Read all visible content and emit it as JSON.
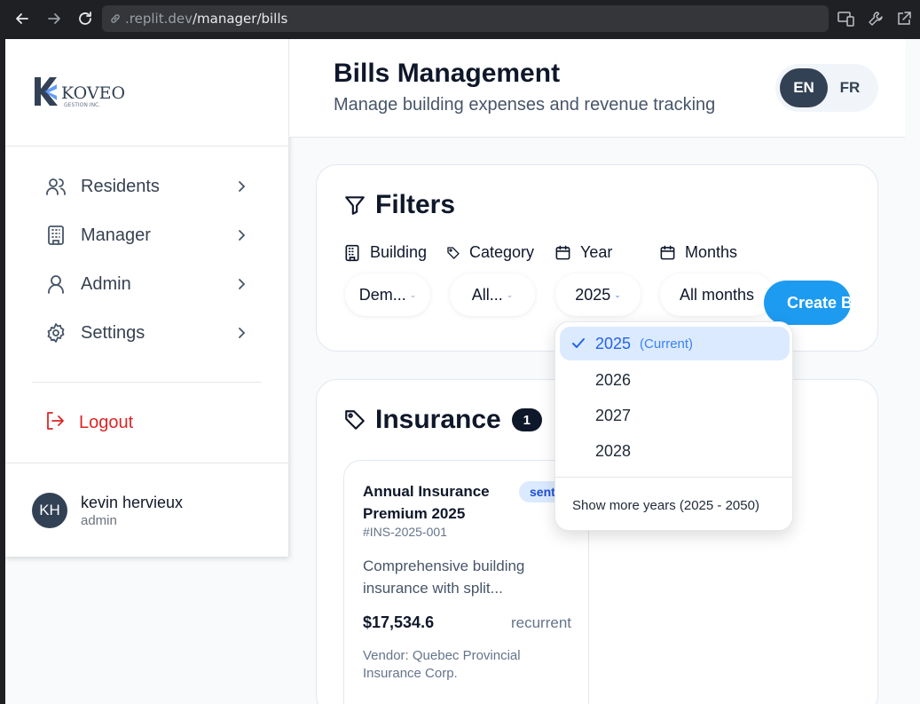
{
  "browser": {
    "url_host": ".replit.dev",
    "url_path": "/manager/bills"
  },
  "sidebar": {
    "logo_text": "KOVEO",
    "logo_subtext": "GESTION INC.",
    "items": [
      {
        "label": "Residents",
        "icon": "users-icon"
      },
      {
        "label": "Manager",
        "icon": "building-icon"
      },
      {
        "label": "Admin",
        "icon": "user-icon"
      },
      {
        "label": "Settings",
        "icon": "gear-icon"
      }
    ],
    "logout_label": "Logout",
    "user": {
      "initials": "KH",
      "name": "kevin hervieux",
      "role": "admin"
    }
  },
  "header": {
    "title": "Bills Management",
    "subtitle": "Manage building expenses and revenue tracking",
    "lang_en": "EN",
    "lang_fr": "FR",
    "active_lang": "EN"
  },
  "filters": {
    "title": "Filters",
    "building_label": "Building",
    "building_value": "Dem...",
    "category_label": "Category",
    "category_value": "All...",
    "year_label": "Year",
    "year_value": "2025",
    "months_label": "Months",
    "months_value": "All months",
    "create_label": "Create Bill"
  },
  "year_dropdown": {
    "options": [
      "2025",
      "2026",
      "2027",
      "2028"
    ],
    "selected": "2025",
    "current_tag": "(Current)",
    "show_more": "Show more years (2025 - 2050)"
  },
  "insurance": {
    "title": "Insurance",
    "count": "1",
    "bill": {
      "title": "Annual Insurance Premium 2025",
      "status": "sent",
      "id": "#INS-2025-001",
      "description": "Comprehensive building insurance with split...",
      "amount": "$17,534.6",
      "type": "recurrent",
      "vendor": "Vendor: Quebec Provincial Insurance Corp."
    }
  },
  "colors": {
    "accent": "#1d9bf0",
    "sidebar_active_dark": "#334155",
    "logout_red": "#dc2626",
    "selected_bg": "#dbeafe"
  }
}
